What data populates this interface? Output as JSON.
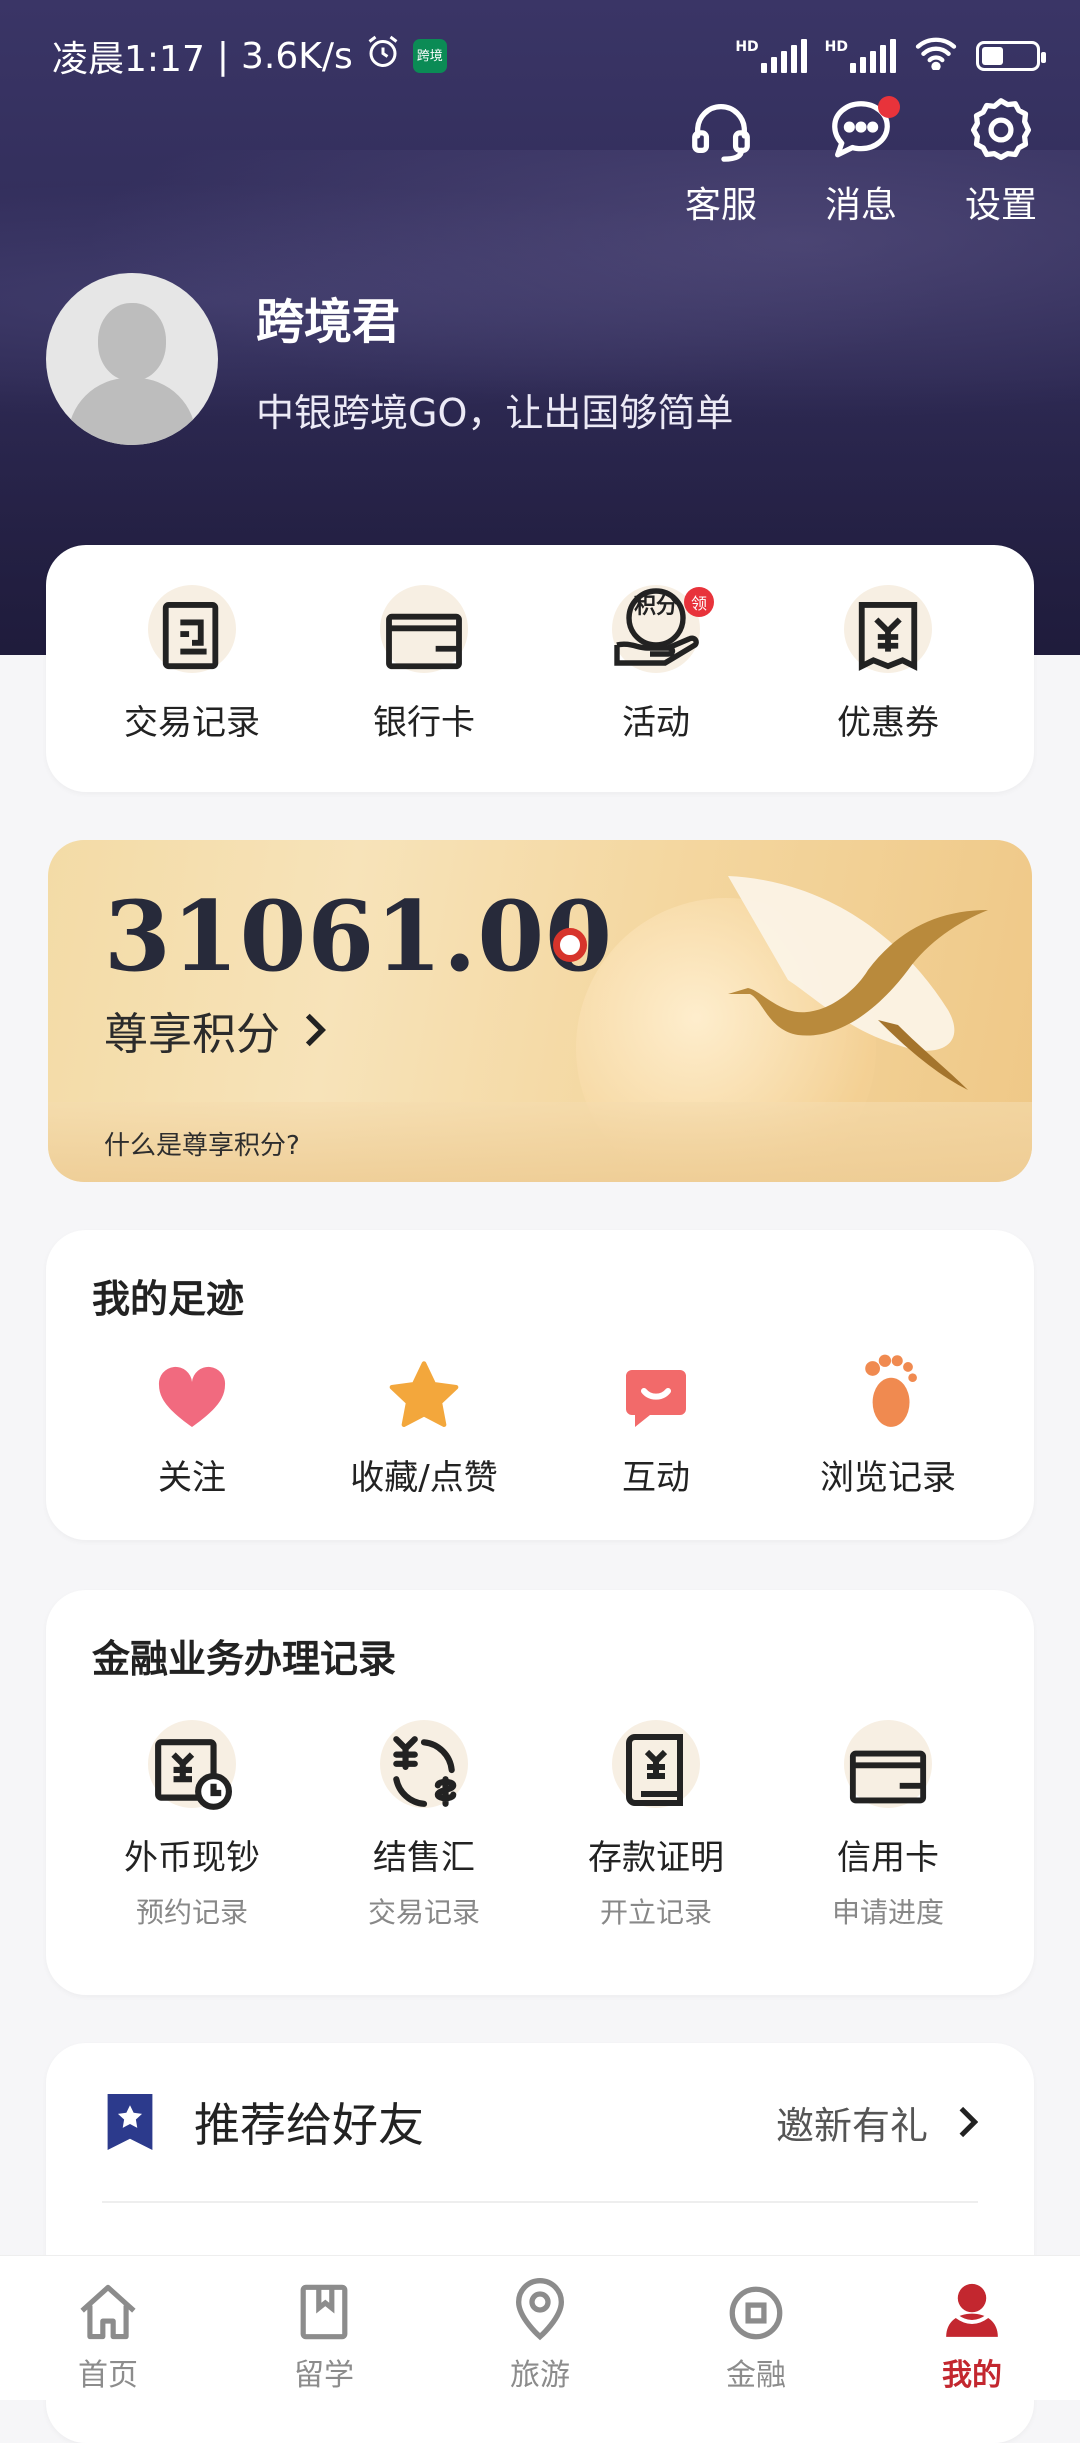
{
  "status_bar": {
    "time": "凌晨1:17",
    "separator": "|",
    "speed": "3.6K/s",
    "app_badge": "跨境",
    "hd1": "HD",
    "hd2": "HD"
  },
  "header": {
    "actions": [
      {
        "label": "客服",
        "icon": "headset-icon"
      },
      {
        "label": "消息",
        "icon": "chat-bubble-icon",
        "has_dot": true
      },
      {
        "label": "设置",
        "icon": "gear-icon"
      }
    ],
    "user_name": "跨境君",
    "slogan": "中银跨境GO，让出国够简单"
  },
  "quick_actions": [
    {
      "label": "交易记录",
      "icon": "receipt-icon"
    },
    {
      "label": "银行卡",
      "icon": "card-icon"
    },
    {
      "label": "活动",
      "icon": "points-hand-icon",
      "badge": "领",
      "icon_text": "积分"
    },
    {
      "label": "优惠券",
      "icon": "coupon-icon"
    }
  ],
  "points": {
    "value": "31061.00",
    "label": "尊享积分",
    "help": "什么是尊享积分?"
  },
  "footprint": {
    "title": "我的足迹",
    "items": [
      {
        "label": "关注",
        "icon": "heart-icon",
        "color": "#f16a7f"
      },
      {
        "label": "收藏/点赞",
        "icon": "star-icon",
        "color": "#f3a73c"
      },
      {
        "label": "互动",
        "icon": "chat-smile-icon",
        "color": "#f26a6a"
      },
      {
        "label": "浏览记录",
        "icon": "footprint-icon",
        "color": "#f08a50"
      }
    ]
  },
  "finance": {
    "title": "金融业务办理记录",
    "items": [
      {
        "label": "外币现钞",
        "sub": "预约记录",
        "icon": "cash-clock-icon"
      },
      {
        "label": "结售汇",
        "sub": "交易记录",
        "icon": "exchange-icon"
      },
      {
        "label": "存款证明",
        "sub": "开立记录",
        "icon": "deposit-certificate-icon"
      },
      {
        "label": "信用卡",
        "sub": "申请进度",
        "icon": "credit-card-icon"
      }
    ]
  },
  "recommend": {
    "title": "推荐给好友",
    "link": "邀新有礼"
  },
  "tabbar": [
    {
      "label": "首页",
      "icon": "home-icon"
    },
    {
      "label": "留学",
      "icon": "book-icon"
    },
    {
      "label": "旅游",
      "icon": "location-pin-icon"
    },
    {
      "label": "金融",
      "icon": "finance-coin-icon"
    },
    {
      "label": "我的",
      "icon": "profile-icon",
      "active": true
    }
  ],
  "colors": {
    "accent": "#c3272f",
    "header_bg": "#302c58",
    "points_gold": "#f4d7a0"
  }
}
